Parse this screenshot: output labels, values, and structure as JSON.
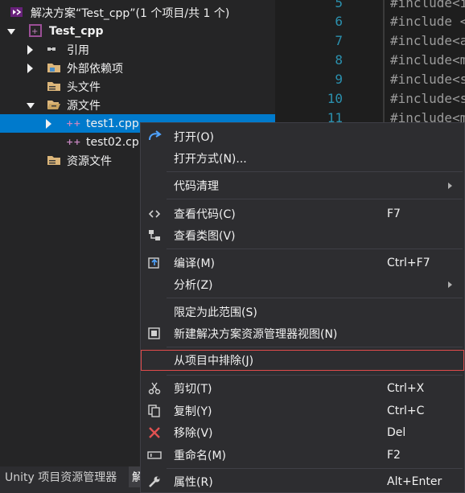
{
  "explorer": {
    "solution_label": "解决方案“Test_cpp”(1 个项目/共 1 个)",
    "project_label": "Test_cpp",
    "references_label": "引用",
    "external_deps_label": "外部依赖项",
    "header_files_label": "头文件",
    "source_files_label": "源文件",
    "file1_label": "test1.cpp",
    "file2_label": "test02.cp",
    "resource_files_label": "资源文件"
  },
  "editor": {
    "line_numbers": [
      "5",
      "6",
      "7",
      "8",
      "9",
      "10",
      "11"
    ],
    "lines": [
      "#include<i",
      "#include <",
      "#include<a",
      "#include<m",
      "#include<s",
      "#include<s",
      "#include<m"
    ]
  },
  "bottom_tabs": {
    "unity_label": "Unity 项目资源管理器",
    "solution_label": "解"
  },
  "context_menu": {
    "open": "打开(O)",
    "open_with": "打开方式(N)...",
    "code_cleanup": "代码清理",
    "view_code": "查看代码(C)",
    "view_code_key": "F7",
    "view_class_diagram": "查看类图(V)",
    "compile": "编译(M)",
    "compile_key": "Ctrl+F7",
    "analyze": "分析(Z)",
    "scope_to_this": "限定为此范围(S)",
    "new_view": "新建解决方案资源管理器视图(N)",
    "exclude_from_project": "从项目中排除(J)",
    "cut": "剪切(T)",
    "cut_key": "Ctrl+X",
    "copy": "复制(Y)",
    "copy_key": "Ctrl+C",
    "remove": "移除(V)",
    "remove_key": "Del",
    "rename": "重命名(M)",
    "rename_key": "F2",
    "properties": "属性(R)",
    "properties_key": "Alt+Enter"
  },
  "colors": {
    "selection": "#007acc",
    "menu_bg": "#2d2d30",
    "highlight_border": "#e24b4b"
  }
}
